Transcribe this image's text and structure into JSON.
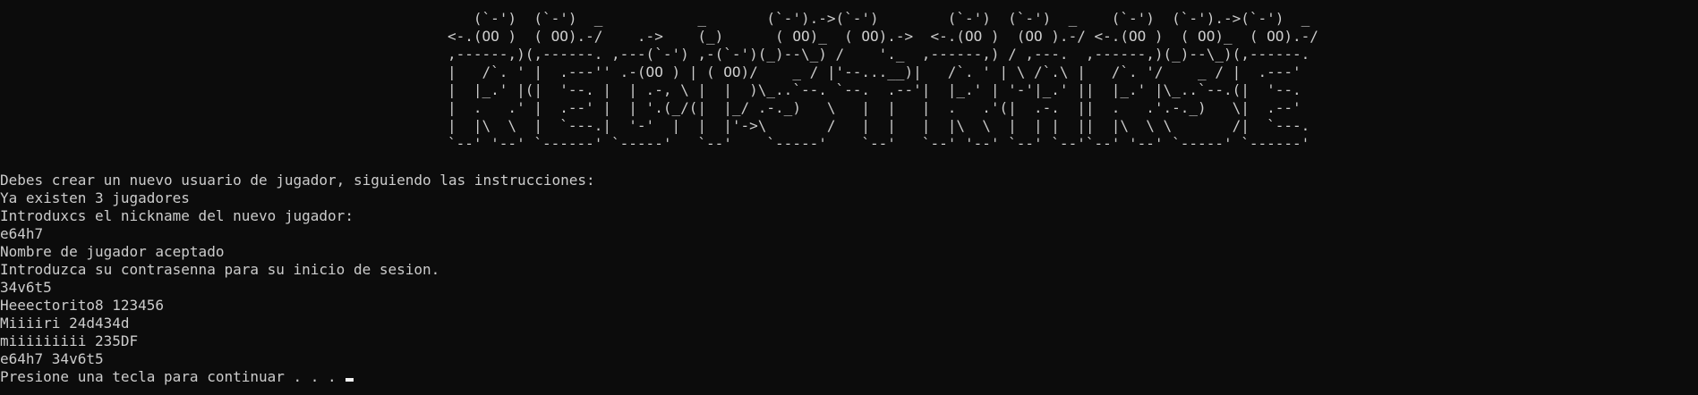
{
  "banner": {
    "lines": [
      "   (`-')  (`-')  _           _       (`-').->(`-')        (`-')  (`-')  _    (`-')  (`-').->(`-')  _ ",
      "<-.(OO )  ( OO).-/    .->    (_)      ( OO)_  ( OO).->  <-.(OO )  (OO ).-/ <-.(OO )  ( OO)_  ( OO).-/ ",
      ",------,)(,------. ,---(`-') ,-(`-')(_)--\\_) /    '._  ,------,) / ,---.  ,------,)(_)--\\_)(,------. ",
      "|   /`. ' |  .---'' .-(OO ) | ( OO)/    _ / |'--...__)|   /`. ' | \\ /`.\\ |   /`. '/    _ / |  .---' ",
      "|  |_.' |(|  '--. |  | .-, \\ |  |  )\\_..`--. `--.  .--'|  |_.' | '-'|_.' ||  |_.' |\\_..`--.(|  '--.  ",
      "|  .   .' |  .--' |  | '.(_/(|  |_/ .-._)   \\   |  |   |  .   .'(|  .-.  ||  .   .'.-._)   \\|  .--'  ",
      "|  |\\  \\  |  `---.|  '-'  |  |  |'->\\       /   |  |   |  |\\  \\  |  | |  ||  |\\  \\ \\       /|  `---. ",
      "`--' '--' `------' `-----'   `--'    `-----'    `--'   `--' '--' `--' `--'`--' '--' `-----' `------' "
    ]
  },
  "output": {
    "lines": [
      "Debes crear un nuevo usuario de jugador, siguiendo las instrucciones:",
      "Ya existen 3 jugadores",
      "Introduxcs el nickname del nuevo jugador:",
      "e64h7",
      "Nombre de jugador aceptado",
      "Introduzca su contrasenna para su inicio de sesion.",
      "34v6t5",
      "Heeectorito8 123456",
      "Miiiiri 24d434d",
      "miiiiiiiii 235DF",
      "e64h7 34v6t5"
    ],
    "prompt": "Presione una tecla para continuar . . . "
  }
}
